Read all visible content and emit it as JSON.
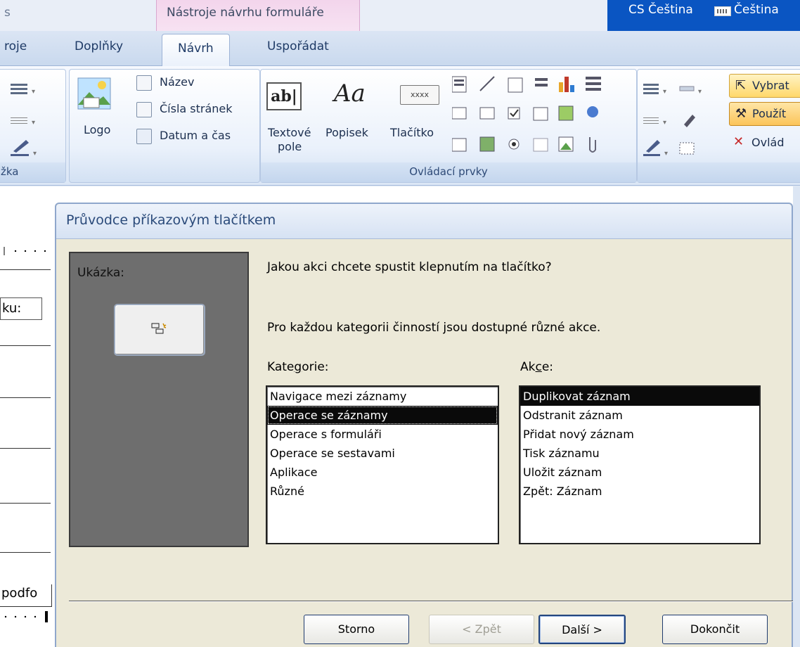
{
  "titlebar": {
    "left_fragment": "s",
    "context_group": "Nástroje návrhu formuláře",
    "language_1": "CS Čeština",
    "language_2": "Čeština"
  },
  "tabs": [
    {
      "label": "roje",
      "active": false
    },
    {
      "label": "Doplňky",
      "active": false
    },
    {
      "label": "Návrh",
      "active": true
    },
    {
      "label": "Uspořádat",
      "active": false
    }
  ],
  "ribbon": {
    "left_group_label": "žka",
    "header_group": {
      "logo_label": "Logo",
      "title_label": "Název",
      "page_numbers_label": "Čísla stránek",
      "date_time_label": "Datum a čas"
    },
    "controls_group": {
      "label": "Ovládací prvky",
      "textbox_label_1": "Textové",
      "textbox_label_2": "pole",
      "label_label": "Popisek",
      "button_label": "Tlačítko",
      "label_icon_text": "Aa",
      "textbox_icon_text": "ab|",
      "button_icon_text": "xxxx"
    },
    "right_group": {
      "select_label": "Vybrat",
      "use_wizards_label": "Použít",
      "activex_label": "Ovlád"
    }
  },
  "document": {
    "field_label_fragment": "ku:",
    "subform_fragment": "podfo"
  },
  "dialog": {
    "title": "Průvodce příkazovým tlačítkem",
    "preview_label": "Ukázka:",
    "question": "Jakou akci chcete spustit klepnutím na tlačítko?",
    "info": "Pro každou kategorii činností jsou dostupné různé akce.",
    "categories_label": "Kategorie:",
    "actions_label": "Akce:",
    "categories": [
      {
        "label": "Navigace mezi záznamy",
        "selected": false
      },
      {
        "label": "Operace se záznamy",
        "selected": true
      },
      {
        "label": "Operace s formuláři",
        "selected": false
      },
      {
        "label": "Operace se sestavami",
        "selected": false
      },
      {
        "label": "Aplikace",
        "selected": false
      },
      {
        "label": "Různé",
        "selected": false
      }
    ],
    "actions": [
      {
        "label": "Duplikovat záznam",
        "selected": true
      },
      {
        "label": "Odstranit záznam",
        "selected": false
      },
      {
        "label": "Přidat nový záznam",
        "selected": false
      },
      {
        "label": "Tisk záznamu",
        "selected": false
      },
      {
        "label": "Uložit záznam",
        "selected": false
      },
      {
        "label": "Zpět: Záznam",
        "selected": false
      }
    ],
    "buttons": {
      "cancel": "Storno",
      "back": "< Zpět",
      "next": "Další >",
      "finish": "Dokončit"
    }
  }
}
